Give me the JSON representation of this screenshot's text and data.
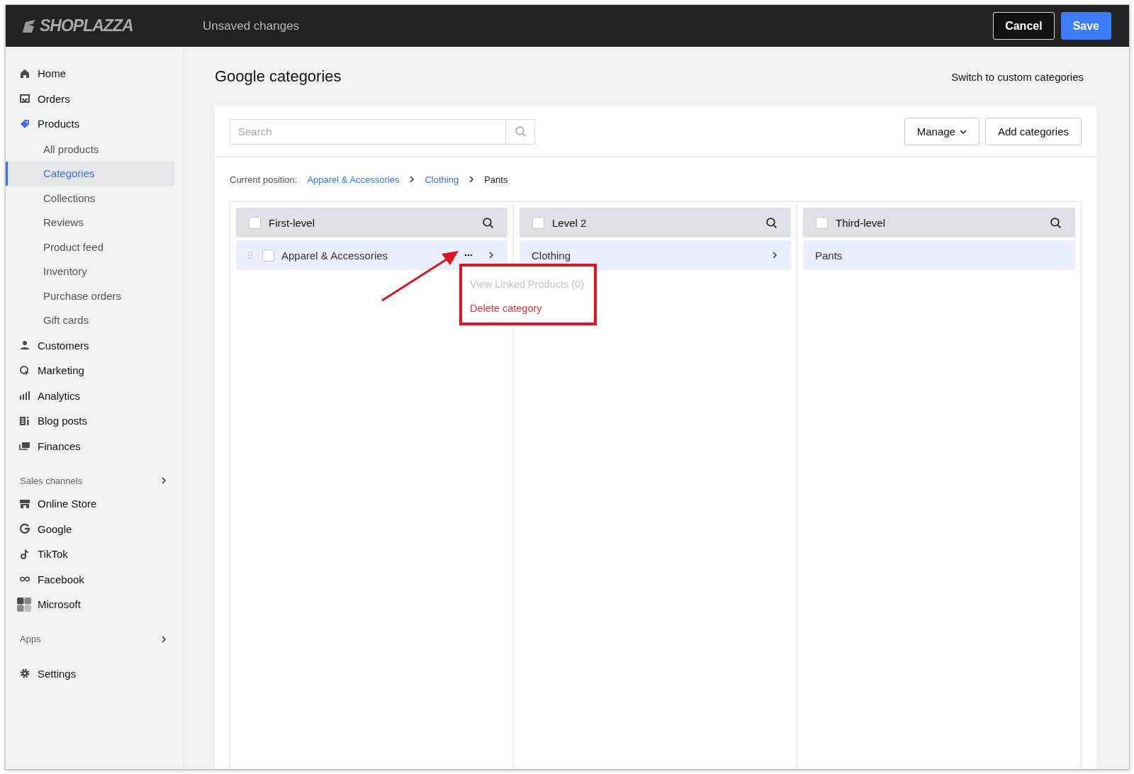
{
  "topbar": {
    "logo": "SHOPLAZZA",
    "status": "Unsaved changes",
    "buttons": [
      {
        "label": "Cancel",
        "kind": "secondary"
      },
      {
        "label": "Save",
        "kind": "primary"
      }
    ]
  },
  "sidebar": {
    "groups": [
      {
        "items": [
          {
            "label": "Home",
            "kind": "home",
            "selected": false
          },
          {
            "label": "Orders",
            "kind": "orders",
            "selected": false
          },
          {
            "label": "Products",
            "kind": "products",
            "selected": true,
            "children": [
              {
                "label": "All products",
                "selected": false
              },
              {
                "label": "Categories",
                "selected": true
              },
              {
                "label": "Collections",
                "selected": false
              },
              {
                "label": "Reviews",
                "selected": false
              },
              {
                "label": "Product feed",
                "selected": false
              },
              {
                "label": "Inventory",
                "selected": false
              },
              {
                "label": "Purchase orders",
                "selected": false
              },
              {
                "label": "Gift cards",
                "selected": false
              }
            ]
          },
          {
            "label": "Customers",
            "kind": "customers",
            "selected": false
          },
          {
            "label": "Marketing",
            "kind": "marketing",
            "selected": false
          },
          {
            "label": "Analytics",
            "kind": "analytics",
            "selected": false
          },
          {
            "label": "Blog posts",
            "kind": "blog",
            "selected": false
          },
          {
            "label": "Finances",
            "kind": "finances",
            "selected": false
          }
        ]
      },
      {
        "heading": "Sales channels",
        "items": [
          {
            "label": "Online Store",
            "kind": "store",
            "selected": false
          },
          {
            "label": "Google",
            "kind": "google",
            "selected": false
          },
          {
            "label": "TikTok",
            "kind": "tiktok",
            "selected": false
          },
          {
            "label": "Facebook",
            "kind": "facebook",
            "selected": false
          },
          {
            "label": "Microsoft",
            "kind": "microsoft",
            "selected": false
          }
        ]
      },
      {
        "heading": "Apps"
      },
      {
        "items": [
          {
            "label": "Settings",
            "kind": "settings",
            "selected": false
          }
        ]
      }
    ]
  },
  "page": {
    "title": "Google categories",
    "switch_link": "Switch to custom categories"
  },
  "toolbar": {
    "search": {
      "placeholder": "Search"
    },
    "buttons": [
      {
        "label": "Manage",
        "kind": "dropdown"
      },
      {
        "label": "Add categories",
        "kind": "plain"
      }
    ]
  },
  "breadcrumb": {
    "label": "Current position:",
    "path": [
      {
        "label": "Apparel & Accessories",
        "kind": "link"
      },
      {
        "label": "Clothing",
        "kind": "link"
      },
      {
        "label": "Pants",
        "kind": "current"
      }
    ]
  },
  "columns": [
    {
      "title": "First-level",
      "checked": false,
      "rows": [
        {
          "label": "Apparel & Accessories",
          "kind": "full",
          "checked": false,
          "selected": true
        }
      ]
    },
    {
      "title": "Level 2",
      "checked": false,
      "rows": [
        {
          "label": "Clothing",
          "kind": "expandable",
          "selected": true
        }
      ]
    },
    {
      "title": "Third-level",
      "checked": false,
      "rows": [
        {
          "label": "Pants",
          "kind": "leaf",
          "selected": true
        }
      ]
    }
  ],
  "menu": {
    "items": [
      {
        "label": "View Linked Products (0)",
        "kind": "normal",
        "disabled": true
      },
      {
        "label": "Delete category",
        "kind": "danger",
        "disabled": false
      }
    ]
  }
}
